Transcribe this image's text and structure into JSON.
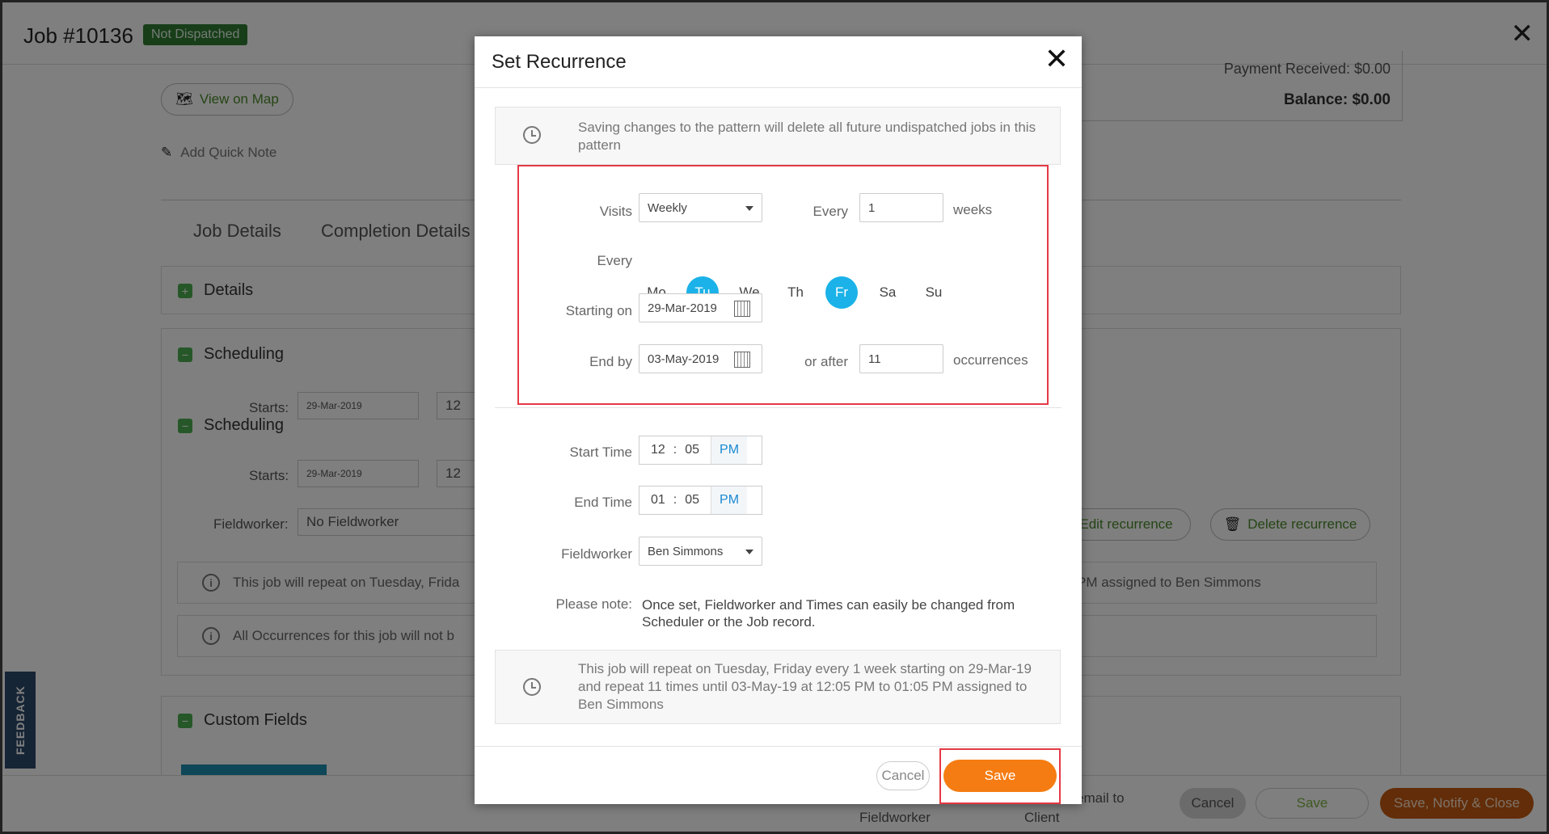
{
  "header": {
    "job_title": "Job #10136",
    "status": "Not Dispatched"
  },
  "page": {
    "view_on_map": "View on Map",
    "add_quick_note": "Add Quick Note",
    "payment_received": "Payment Received:  $0.00",
    "balance": "Balance:  $0.00",
    "tabs": [
      "Job Details",
      "Completion Details"
    ],
    "sections": {
      "details": "Details",
      "scheduling": "Scheduling",
      "custom_fields": "Custom Fields"
    },
    "starts_label": "Starts:",
    "start_date": "29-Mar-2019",
    "start_hour": "12",
    "fieldworker_label": "Fieldworker:",
    "fieldworker_value": "No Fieldworker",
    "edit_recurrence": "Edit recurrence",
    "delete_recurrence": "Delete recurrence",
    "info_1_left": "This job will repeat on Tuesday, Frida",
    "info_1_right": "PM assigned to Ben Simmons",
    "info_2_left": "All Occurrences for this job will not b",
    "bottom_fieldworker": "Fieldworker",
    "bottom_email": "email to",
    "bottom_client": "Client",
    "cancel": "Cancel",
    "save": "Save",
    "save_notify_close": "Save, Notify & Close",
    "feedback": "FEEDBACK"
  },
  "modal": {
    "title": "Set Recurrence",
    "warning": "Saving changes to the pattern will delete all future undispatched jobs in this pattern",
    "visits_label": "Visits",
    "visits_value": "Weekly",
    "every_label": "Every",
    "every_value": "1",
    "every_unit": "weeks",
    "days_label": "Every",
    "days": [
      {
        "label": "Mo",
        "selected": false
      },
      {
        "label": "Tu",
        "selected": true
      },
      {
        "label": "We",
        "selected": false
      },
      {
        "label": "Th",
        "selected": false
      },
      {
        "label": "Fr",
        "selected": true
      },
      {
        "label": "Sa",
        "selected": false
      },
      {
        "label": "Su",
        "selected": false
      }
    ],
    "starting_on_label": "Starting on",
    "starting_on_value": "29-Mar-2019",
    "end_by_label": "End by",
    "end_by_value": "03-May-2019",
    "or_after_label": "or after",
    "or_after_value": "11",
    "occurrences_label": "occurrences",
    "start_time_label": "Start Time",
    "start_time": {
      "hour": "12",
      "minute": "05",
      "ampm": "PM"
    },
    "end_time_label": "End Time",
    "end_time": {
      "hour": "01",
      "minute": "05",
      "ampm": "PM"
    },
    "fieldworker_label": "Fieldworker",
    "fieldworker_value": "Ben Simmons",
    "note_label": "Please note:",
    "note_text": "Once set, Fieldworker and Times can easily be changed from Scheduler or the Job record.",
    "summary": "This job will repeat on Tuesday, Friday every 1 week starting on 29-Mar-19 and repeat 11 times until 03-May-19 at 12:05 PM to 01:05 PM assigned to Ben Simmons",
    "cancel": "Cancel",
    "save": "Save"
  },
  "colors": {
    "accent_orange": "#f57c12",
    "day_selected": "#1ab2e8",
    "highlight_red": "#e53945",
    "status_green": "#2e7d32"
  }
}
